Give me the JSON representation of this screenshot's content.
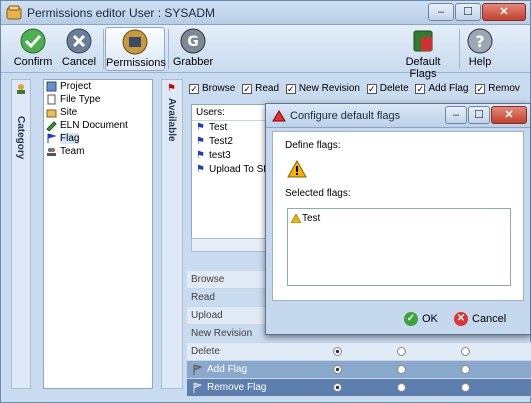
{
  "window": {
    "title": "Permissions editor User : SYSADM",
    "min": "‒",
    "max": "☐",
    "close": "✕"
  },
  "toolbar": {
    "confirm": "Confirm",
    "cancel": "Cancel",
    "permissions": "Permissions",
    "grabber": "Grabber",
    "default_flags": "Default Flags",
    "help": "Help"
  },
  "sidebar": {
    "category_label": "Category",
    "available_label": "Available"
  },
  "tree": {
    "items": [
      {
        "label": "Project"
      },
      {
        "label": "File Type"
      },
      {
        "label": "Site"
      },
      {
        "label": "ELN Document"
      },
      {
        "label": "Flag"
      },
      {
        "label": "Team"
      }
    ]
  },
  "permission_checks": [
    {
      "label": "Browse",
      "checked": true
    },
    {
      "label": "Read",
      "checked": true
    },
    {
      "label": "New Revision",
      "checked": true
    },
    {
      "label": "Delete",
      "checked": true
    },
    {
      "label": "Add Flag",
      "checked": true
    },
    {
      "label": "Remov",
      "checked": true
    }
  ],
  "users": {
    "header": "Users:",
    "items": [
      "Test",
      "Test2",
      "test3",
      "Upload To SL"
    ]
  },
  "grid": {
    "rows": [
      {
        "label": "Browse"
      },
      {
        "label": "Read"
      },
      {
        "label": "Upload"
      },
      {
        "label": "New Revision"
      },
      {
        "label": "Delete"
      },
      {
        "label": "Add Flag"
      },
      {
        "label": "Remove Flag"
      }
    ]
  },
  "dialog": {
    "title": "Configure default flags",
    "define_flags": "Define flags:",
    "selected_flags": "Selected flags:",
    "selected_items": [
      "Test"
    ],
    "ok": "OK",
    "cancel": "Cancel"
  }
}
